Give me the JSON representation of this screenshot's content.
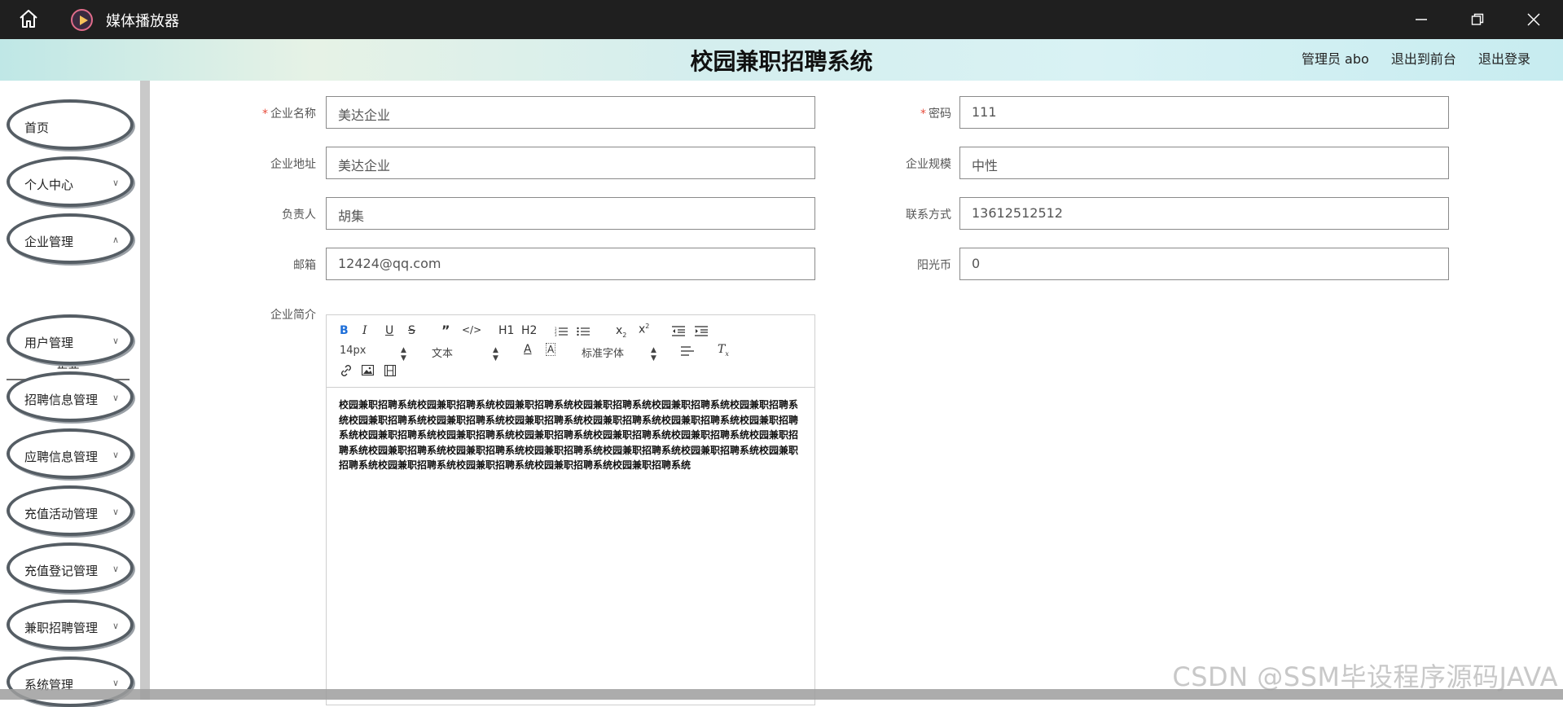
{
  "window": {
    "app_title": "媒体播放器"
  },
  "header": {
    "system_title": "校园兼职招聘系统",
    "user_label": "管理员 abo",
    "back_to_front": "退出到前台",
    "logout": "退出登录"
  },
  "sidebar": {
    "items": [
      {
        "label": "首页",
        "has_chevron": false
      },
      {
        "label": "个人中心",
        "has_chevron": true
      },
      {
        "label": "企业管理",
        "has_chevron": true
      },
      {
        "label": "用户管理",
        "has_chevron": true
      },
      {
        "label": "招聘信息管理",
        "has_chevron": true
      },
      {
        "label": "应聘信息管理",
        "has_chevron": true
      },
      {
        "label": "充值活动管理",
        "has_chevron": true
      },
      {
        "label": "充值登记管理",
        "has_chevron": true
      },
      {
        "label": "兼职招聘管理",
        "has_chevron": true
      },
      {
        "label": "系统管理",
        "has_chevron": true
      }
    ],
    "sub_item": "企业"
  },
  "form": {
    "company_name": {
      "label": "企业名称",
      "required": true,
      "value": "美达企业"
    },
    "password": {
      "label": "密码",
      "required": true,
      "value": "111"
    },
    "company_address": {
      "label": "企业地址",
      "required": false,
      "value": "美达企业"
    },
    "company_scale": {
      "label": "企业规模",
      "required": false,
      "value": "中性"
    },
    "principal": {
      "label": "负责人",
      "required": false,
      "value": "胡集"
    },
    "contact": {
      "label": "联系方式",
      "required": false,
      "value": "13612512512"
    },
    "email": {
      "label": "邮箱",
      "required": false,
      "value": "12424@qq.com"
    },
    "sun_coins": {
      "label": "阳光币",
      "required": false,
      "value": "0"
    },
    "intro": {
      "label": "企业简介"
    }
  },
  "editor": {
    "font_size": "14px",
    "text_type": "文本",
    "font_family": "标准字体",
    "h1": "H1",
    "h2": "H2",
    "content": "校园兼职招聘系统校园兼职招聘系统校园兼职招聘系统校园兼职招聘系统校园兼职招聘系统校园兼职招聘系统校园兼职招聘系统校园兼职招聘系统校园兼职招聘系统校园兼职招聘系统校园兼职招聘系统校园兼职招聘系统校园兼职招聘系统校园兼职招聘系统校园兼职招聘系统校园兼职招聘系统校园兼职招聘系统校园兼职招聘系统校园兼职招聘系统校园兼职招聘系统校园兼职招聘系统校园兼职招聘系统校园兼职招聘系统校园兼职招聘系统校园兼职招聘系统校园兼职招聘系统校园兼职招聘系统校园兼职招聘系统"
  },
  "watermark": "CSDN @SSM毕设程序源码JAVA"
}
